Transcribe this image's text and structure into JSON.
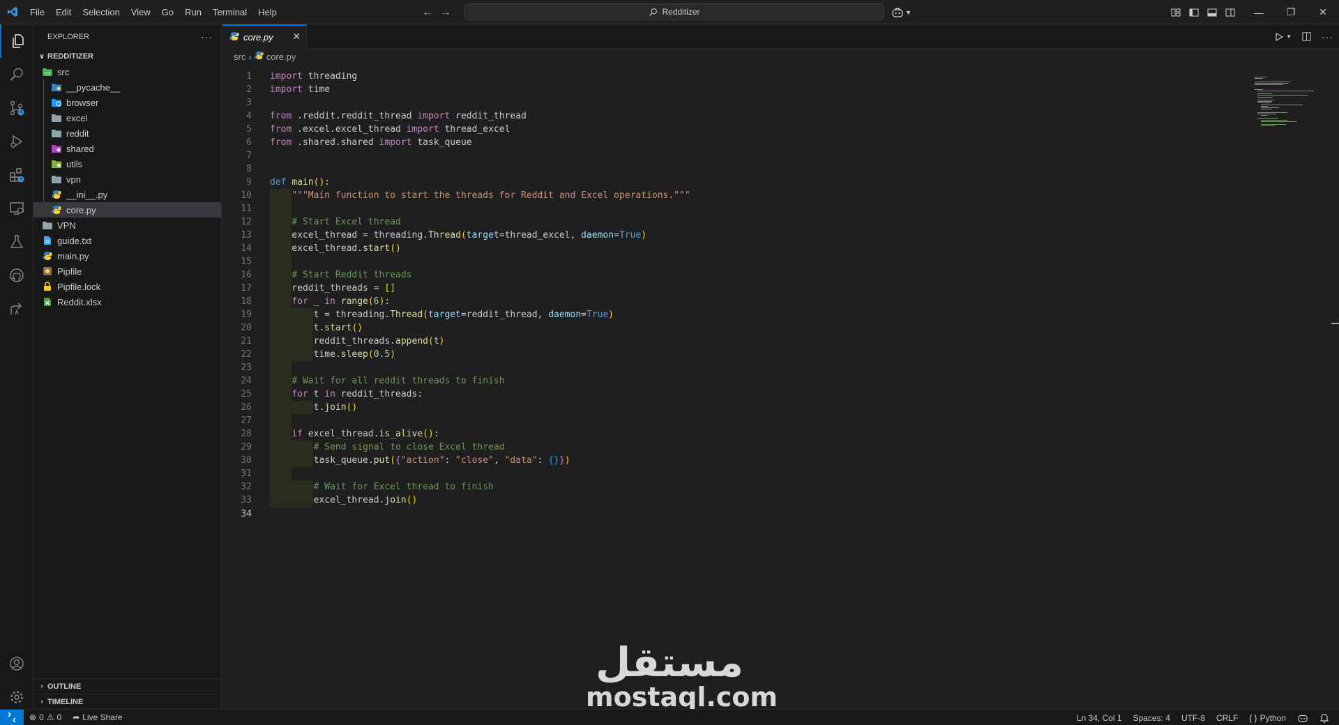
{
  "menu": [
    "File",
    "Edit",
    "Selection",
    "View",
    "Go",
    "Run",
    "Terminal",
    "Help"
  ],
  "command_center": {
    "label": "Redditizer"
  },
  "sidebar": {
    "title": "EXPLORER",
    "root": "REDDITIZER",
    "tree": [
      {
        "label": "src",
        "type": "folder-src"
      },
      {
        "label": "__pycache__",
        "type": "folder-pycache"
      },
      {
        "label": "browser",
        "type": "folder-browser"
      },
      {
        "label": "excel",
        "type": "folder"
      },
      {
        "label": "reddit",
        "type": "folder"
      },
      {
        "label": "shared",
        "type": "folder-shared"
      },
      {
        "label": "utils",
        "type": "folder-utils"
      },
      {
        "label": "vpn",
        "type": "folder"
      },
      {
        "label": "__ini__.py",
        "type": "python"
      },
      {
        "label": "core.py",
        "type": "python"
      },
      {
        "label": "VPN",
        "type": "folder"
      },
      {
        "label": "guide.txt",
        "type": "text"
      },
      {
        "label": "main.py",
        "type": "python"
      },
      {
        "label": "Pipfile",
        "type": "pipfile"
      },
      {
        "label": "Pipfile.lock",
        "type": "lock"
      },
      {
        "label": "Reddit.xlsx",
        "type": "excel"
      }
    ],
    "outline": "OUTLINE",
    "timeline": "TIMELINE"
  },
  "editor": {
    "tab_label": "core.py",
    "breadcrumb": [
      "src",
      "core.py"
    ],
    "current_line": 34
  },
  "code_lines": [
    "import threading",
    "import time",
    "",
    "from .reddit.reddit_thread import reddit_thread",
    "from .excel.excel_thread import thread_excel",
    "from .shared.shared import task_queue",
    "",
    "",
    "def main():",
    "    \"\"\"Main function to start the threads for Reddit and Excel operations.\"\"\"",
    "",
    "    # Start Excel thread",
    "    excel_thread = threading.Thread(target=thread_excel, daemon=True)",
    "    excel_thread.start()",
    "",
    "    # Start Reddit threads",
    "    reddit_threads = []",
    "    for _ in range(6):",
    "        t = threading.Thread(target=reddit_thread, daemon=True)",
    "        t.start()",
    "        reddit_threads.append(t)",
    "        time.sleep(0.5)",
    "",
    "    # Wait for all reddit threads to finish",
    "    for t in reddit_threads:",
    "        t.join()",
    "",
    "    if excel_thread.is_alive():",
    "        # Send signal to close Excel thread",
    "        task_queue.put({\"action\": \"close\", \"data\": {}})",
    "",
    "        # Wait for Excel thread to finish",
    "        excel_thread.join()",
    ""
  ],
  "watermark": {
    "arabic": "مستقل",
    "latin": "mostaql.com"
  },
  "statusbar": {
    "errors": "0",
    "warnings": "0",
    "live_share": "Live Share",
    "position": "Ln 34, Col 1",
    "spaces": "Spaces: 4",
    "encoding": "UTF-8",
    "eol": "CRLF",
    "language_icon": "{ }",
    "language": "Python"
  },
  "colors": {
    "accent": "#0078d4",
    "keyword": "#c586c0",
    "declaration": "#569cd6",
    "function": "#dcdcaa",
    "string": "#ce9178",
    "comment": "#6a9955",
    "number": "#b5cea8",
    "parameter": "#9cdcfe"
  }
}
